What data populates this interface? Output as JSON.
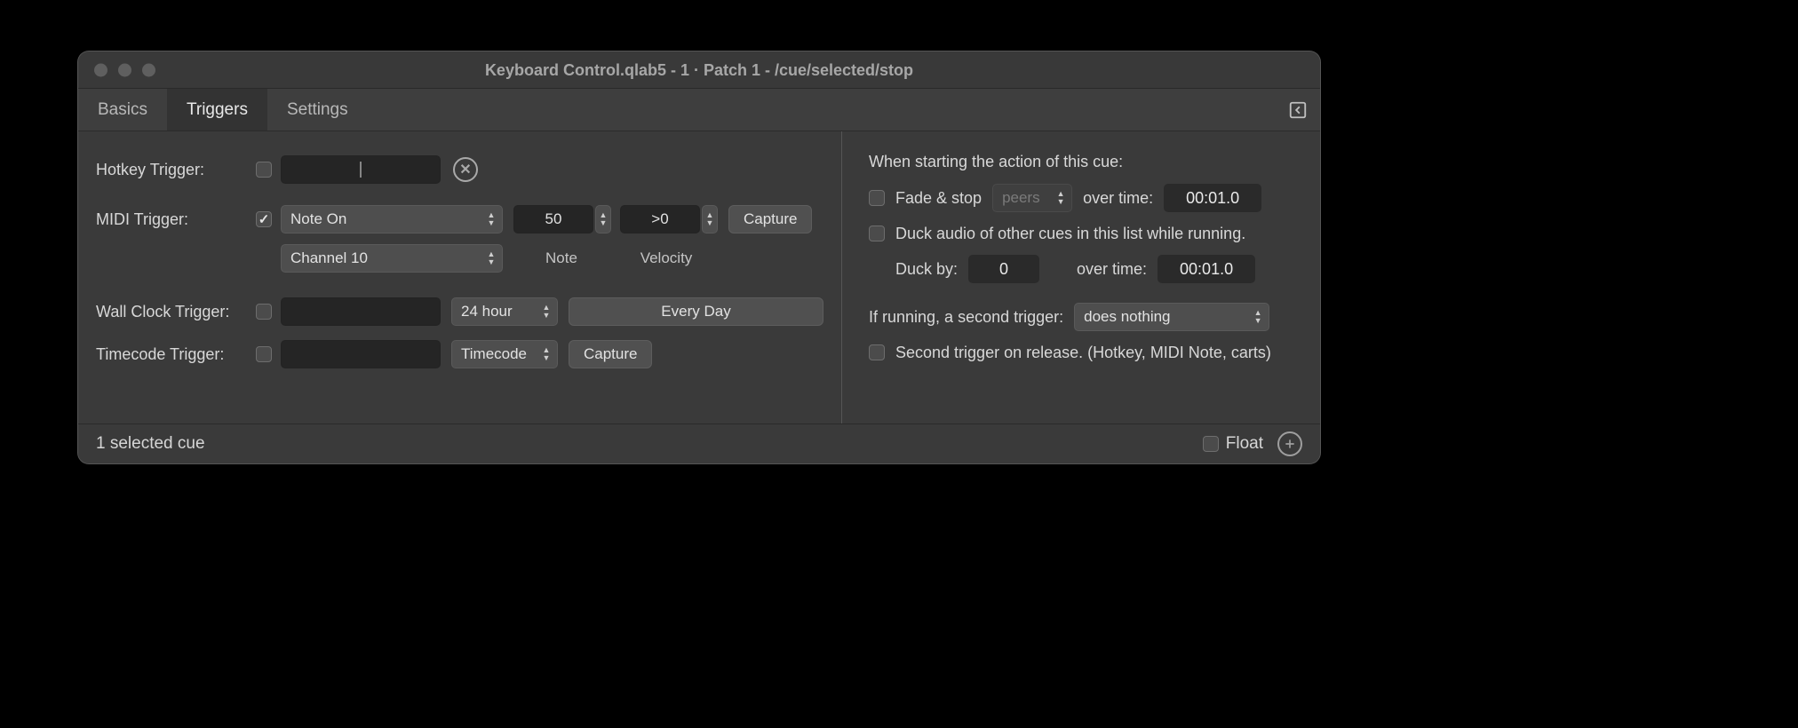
{
  "window": {
    "title": "Keyboard Control.qlab5 - 1 · Patch 1 - /cue/selected/stop"
  },
  "tabs": {
    "basics": "Basics",
    "triggers": "Triggers",
    "settings": "Settings"
  },
  "left": {
    "hotkey_label": "Hotkey Trigger:",
    "hotkey_value": "",
    "midi_label": "MIDI Trigger:",
    "midi_type": "Note On",
    "midi_note_value": "50",
    "midi_note_label": "Note",
    "midi_vel_value": ">0",
    "midi_vel_label": "Velocity",
    "midi_capture": "Capture",
    "midi_channel": "Channel 10",
    "wall_label": "Wall Clock Trigger:",
    "wall_value": "",
    "wall_format": "24 hour",
    "wall_days": "Every Day",
    "tc_label": "Timecode Trigger:",
    "tc_value": "",
    "tc_select": "Timecode",
    "tc_capture": "Capture"
  },
  "right": {
    "header": "When starting the action of this cue:",
    "fade_stop": "Fade & stop",
    "peers": "peers",
    "over_time": "over time:",
    "fade_time": "00:01.0",
    "duck_label": "Duck audio of other cues in this list while running.",
    "duck_by": "Duck by:",
    "duck_value": "0",
    "duck_time": "00:01.0",
    "second_trigger_label": "If running, a second trigger:",
    "second_trigger_value": "does nothing",
    "second_release": "Second trigger on release. (Hotkey, MIDI Note, carts)"
  },
  "status": {
    "selected": "1 selected cue",
    "float": "Float"
  }
}
